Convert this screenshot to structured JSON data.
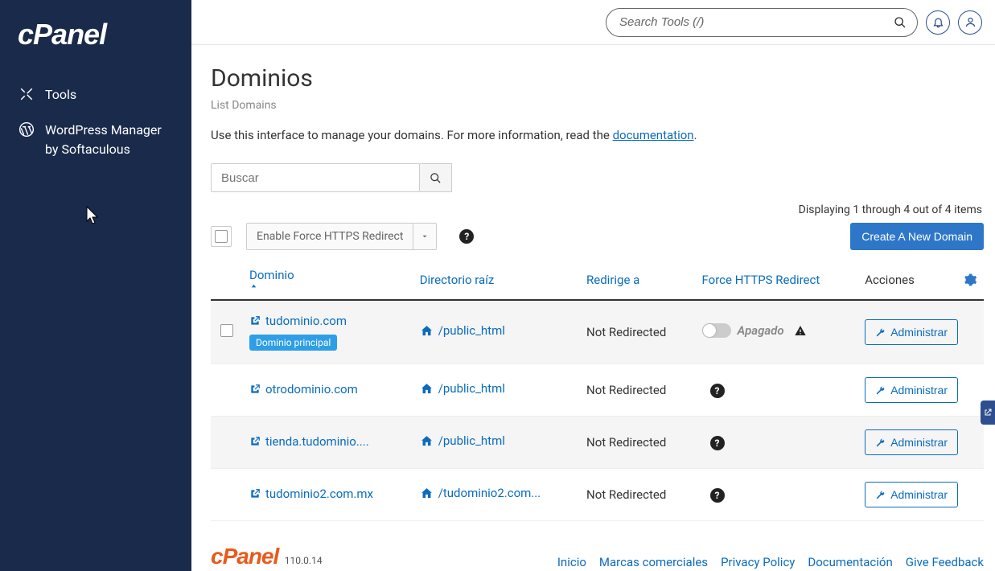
{
  "brand": {
    "name": "cPanel"
  },
  "sidebar": {
    "items": [
      {
        "label": "Tools",
        "icon": "tools-cross-icon"
      },
      {
        "label": "WordPress Manager by Softaculous",
        "icon": "wordpress-icon"
      }
    ]
  },
  "topbar": {
    "search_placeholder": "Search Tools (/)"
  },
  "page": {
    "title": "Dominios",
    "subtitle": "List Domains",
    "intro_prefix": "Use this interface to manage your domains. For more information, read the ",
    "doc_link_label": "documentation",
    "intro_suffix": "."
  },
  "filters": {
    "search_placeholder": "Buscar",
    "https_button": "Enable Force HTTPS Redirect",
    "create_button": "Create A New Domain",
    "count_text": "Displaying 1 through 4 out of 4 items"
  },
  "columns": {
    "domain": "Dominio",
    "docroot": "Directorio raíz",
    "redirect": "Redirige a",
    "force_https": "Force HTTPS Redirect",
    "actions": "Acciones"
  },
  "toggle": {
    "off_label": "Apagado"
  },
  "manage_label": "Administrar",
  "rows": [
    {
      "domain": "tudominio.com",
      "docroot": "/public_html",
      "redirect": "Not Redirected",
      "primary_badge": "Dominio principal",
      "https_mode": "toggle_off"
    },
    {
      "domain": "otrodominio.com",
      "docroot": "/public_html",
      "redirect": "Not Redirected",
      "https_mode": "help"
    },
    {
      "domain": "tienda.tudominio....",
      "docroot": "/public_html",
      "redirect": "Not Redirected",
      "https_mode": "help"
    },
    {
      "domain": "tudominio2.com.mx",
      "docroot": "/tudominio2.com...",
      "redirect": "Not Redirected",
      "https_mode": "help"
    }
  ],
  "footer": {
    "version": "110.0.14",
    "links": [
      "Inicio",
      "Marcas comerciales",
      "Privacy Policy",
      "Documentación",
      "Give Feedback"
    ]
  }
}
